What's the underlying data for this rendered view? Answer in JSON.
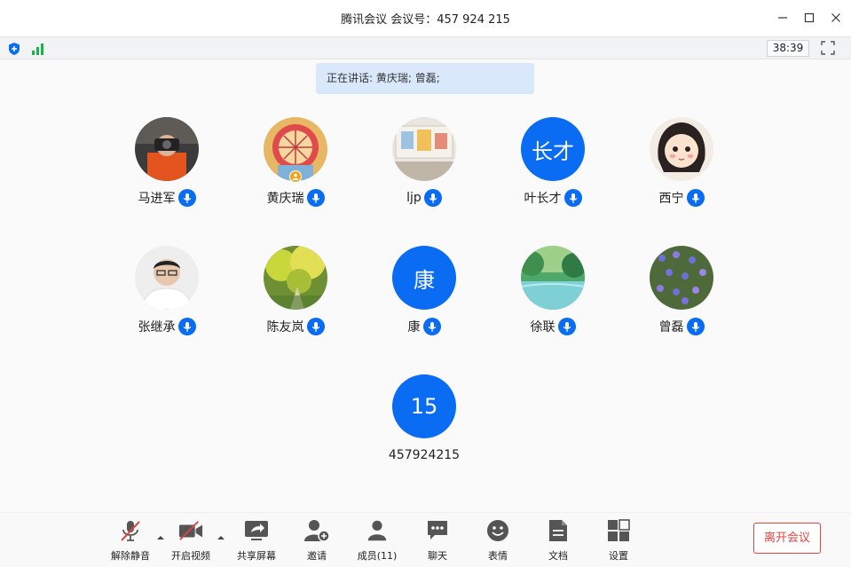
{
  "window": {
    "title": "腾讯会议 会议号：457 924 215"
  },
  "statusbar": {
    "timer": "38:39"
  },
  "speaking": {
    "text": "正在讲话: 黄庆瑞; 曾磊;"
  },
  "participants": [
    {
      "name": "马进军",
      "avatar": "photo",
      "mic": "on"
    },
    {
      "name": "黄庆瑞",
      "avatar": "photo",
      "mic": "on",
      "host": true
    },
    {
      "name": "ljp",
      "avatar": "photo",
      "mic": "on"
    },
    {
      "name": "叶长才",
      "avatar": "text",
      "avatar_text": "长才",
      "mic": "on"
    },
    {
      "name": "西宁",
      "avatar": "photo",
      "mic": "on"
    },
    {
      "name": "张继承",
      "avatar": "photo",
      "mic": "on"
    },
    {
      "name": "陈友岚",
      "avatar": "photo",
      "mic": "on"
    },
    {
      "name": "康",
      "avatar": "text",
      "avatar_text": "康",
      "mic": "on"
    },
    {
      "name": "徐联",
      "avatar": "photo",
      "mic": "on"
    },
    {
      "name": "曾磊",
      "avatar": "photo",
      "mic": "on"
    },
    {
      "name": "457924215",
      "avatar": "text",
      "avatar_text": "15"
    }
  ],
  "toolbar": {
    "unmute": "解除静音",
    "start_video": "开启视频",
    "share_screen": "共享屏幕",
    "invite": "邀请",
    "members": "成员(11)",
    "chat": "聊天",
    "reactions": "表情",
    "docs": "文档",
    "settings": "设置",
    "leave": "离开会议"
  },
  "colors": {
    "accent": "#0a6cf2",
    "leave": "#e0453f",
    "speaking_bg": "#d9e8fb"
  }
}
